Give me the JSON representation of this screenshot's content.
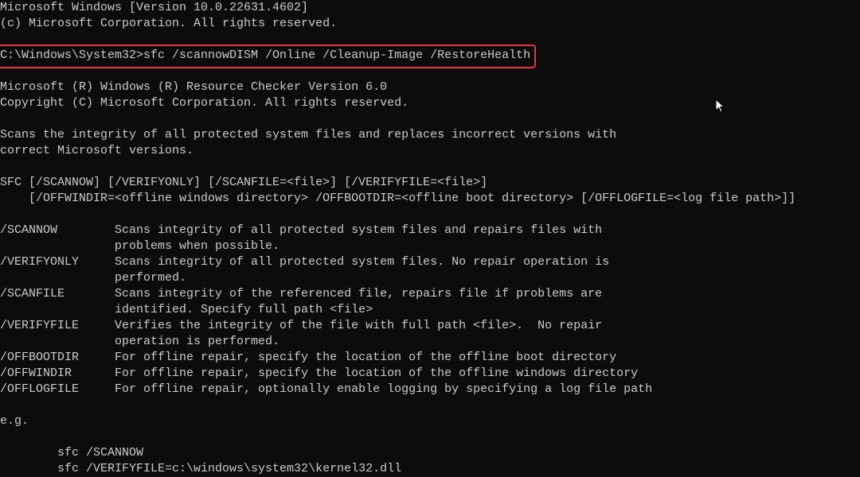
{
  "terminal": {
    "lines": [
      "Microsoft Windows [Version 10.0.22631.4602]",
      "(c) Microsoft Corporation. All rights reserved.",
      "",
      "C:\\Windows\\System32>sfc /scannowDISM /Online /Cleanup-Image /RestoreHealth",
      "",
      "Microsoft (R) Windows (R) Resource Checker Version 6.0",
      "Copyright (C) Microsoft Corporation. All rights reserved.",
      "",
      "Scans the integrity of all protected system files and replaces incorrect versions with",
      "correct Microsoft versions.",
      "",
      "SFC [/SCANNOW] [/VERIFYONLY] [/SCANFILE=<file>] [/VERIFYFILE=<file>]",
      "    [/OFFWINDIR=<offline windows directory> /OFFBOOTDIR=<offline boot directory> [/OFFLOGFILE=<log file path>]]",
      "",
      "/SCANNOW        Scans integrity of all protected system files and repairs files with",
      "                problems when possible.",
      "/VERIFYONLY     Scans integrity of all protected system files. No repair operation is",
      "                performed.",
      "/SCANFILE       Scans integrity of the referenced file, repairs file if problems are",
      "                identified. Specify full path <file>",
      "/VERIFYFILE     Verifies the integrity of the file with full path <file>.  No repair",
      "                operation is performed.",
      "/OFFBOOTDIR     For offline repair, specify the location of the offline boot directory",
      "/OFFWINDIR      For offline repair, specify the location of the offline windows directory",
      "/OFFLOGFILE     For offline repair, optionally enable logging by specifying a log file path",
      "",
      "e.g.",
      "",
      "        sfc /SCANNOW",
      "        sfc /VERIFYFILE=c:\\windows\\system32\\kernel32.dll"
    ],
    "highlight_color": "#e5383e",
    "text_color": "#cccccc",
    "background_color": "#0c0c0c"
  }
}
